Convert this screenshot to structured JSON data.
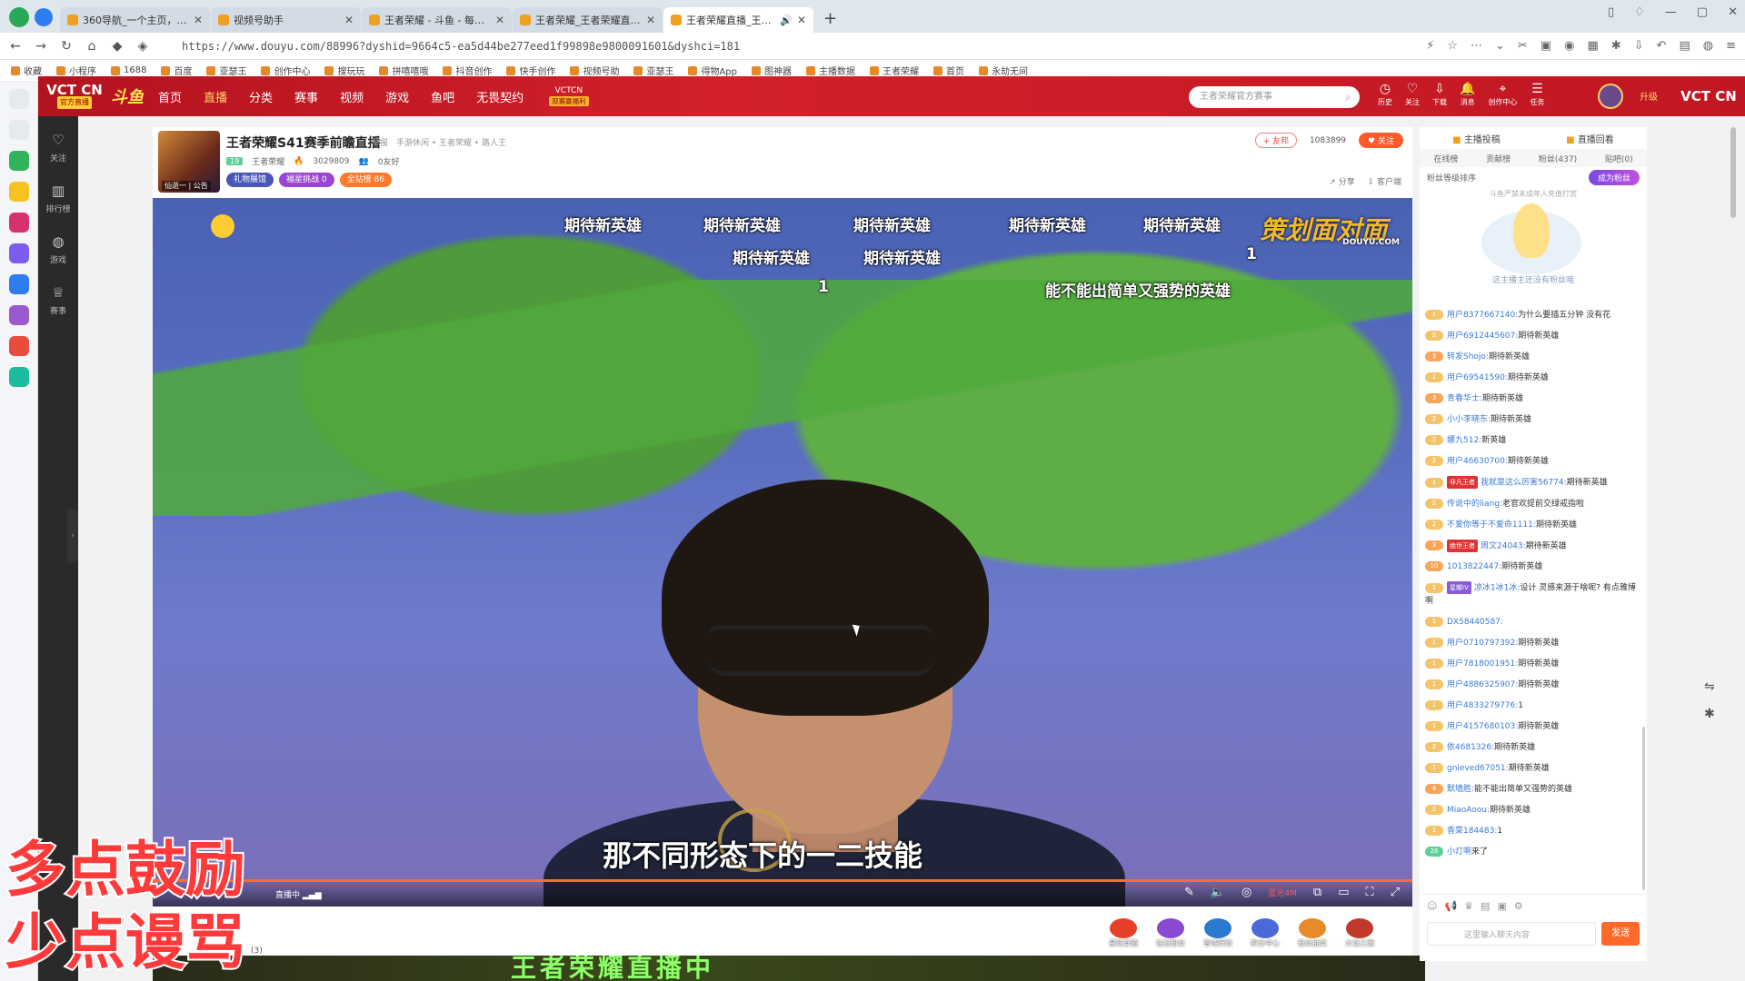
{
  "browser": {
    "tabs": [
      {
        "title": "360导航_一个主页，整个世界"
      },
      {
        "title": "视频号助手"
      },
      {
        "title": "王者荣耀 - 斗鱼 - 每个人的直"
      },
      {
        "title": "王者荣耀_王者荣耀直播_王者"
      },
      {
        "title": "王者荣耀直播_王者荣耀直"
      }
    ],
    "new_tab": "+",
    "url": "https://www.douyu.com/88996?dyshid=9664c5-ea5d44be277eed1f99898e9800091601&dyshci=181",
    "bookmarks": [
      "收藏",
      "小程序",
      "1688",
      "百度",
      "亚瑟王",
      "创作中心",
      "搜玩玩",
      "拼嘻嘻哦",
      "抖音创作",
      "快手创作",
      "视频号助",
      "亚瑟王",
      "得物App",
      "图神器",
      "主播数据",
      "王者荣耀",
      "首页",
      "永劫无间"
    ]
  },
  "site": {
    "vct_badge": "VCT CN",
    "vct_badge_sub": "官方直播",
    "logo": "斗鱼",
    "nav": [
      "首页",
      "直播",
      "分类",
      "赛事",
      "视频",
      "游戏",
      "鱼吧",
      "无畏契约"
    ],
    "nav_current": "直播",
    "vctcn_tag": "VCTCN",
    "vctcn_sub": "观赛赢福利",
    "search_placeholder": "王者荣耀官方赛事",
    "header_icons": [
      "历史",
      "关注",
      "下载",
      "消息",
      "创作中心",
      "任务"
    ],
    "upgrade": "升级"
  },
  "rail": [
    "关注",
    "排行榜",
    "游戏",
    "赛事"
  ],
  "room": {
    "avatar_tag": "仙逝一 | 公告",
    "title": "王者荣耀S41赛季前瞻直播",
    "report": "举报",
    "categories": "手游休闲 • 王者荣耀 • 路人王",
    "level": "19",
    "anchor": "王者荣耀",
    "heat": "3029809",
    "fans": "0友好",
    "badges": [
      "礼物展馆",
      "福星挑战 0",
      "全站榜 86"
    ],
    "share_btn": "+ 友邦",
    "count": "1083899",
    "follow_btn": "关注",
    "sub_actions": [
      "分享",
      "客户端"
    ]
  },
  "video": {
    "danmaku": [
      "期待新英雄",
      "期待新英雄",
      "期待新英雄",
      "期待新英雄",
      "期待新英雄",
      "期待新英雄",
      "期待新英雄",
      "1",
      "1",
      "能不能出简单又强势的英雄"
    ],
    "watermark": "策划面对面",
    "watermark_sub": "DOUYU.COM",
    "subtitle": "那不同形态下的一二技能",
    "live_label": "直播中",
    "quality": "蓝光4M",
    "progress_fraction": 1.0
  },
  "gifts": [
    "星际穿越",
    "钻石粉丝",
    "雪域历险",
    "积分中心",
    "粉丝抽奖",
    "大话三国"
  ],
  "gift_bottom": "(3)",
  "bottom_banner": "王者荣耀直播中",
  "overlay": [
    "多点鼓励",
    "少点谩骂"
  ],
  "chat": {
    "header": [
      "主播投稿",
      "直播回看"
    ],
    "tabs": [
      "在线榜",
      "贡献榜",
      "粉丝(437)",
      "贴吧(0)"
    ],
    "fan_rank_label": "粉丝等级排序",
    "fan_btn": "成为粉丝",
    "fan_note": "斗鱼严禁未成年人充值打赏",
    "fan_hint": "这主播主还没有粉丝哦",
    "messages": [
      {
        "lv": "1",
        "name": "用户8377667140:",
        "text": "为什么要插五分钟 没有花"
      },
      {
        "lv": "2",
        "name": "用户6912445607:",
        "text": "期待新英雄"
      },
      {
        "lv": "3",
        "name": "转发Shojo:",
        "text": "期待新英雄"
      },
      {
        "lv": "1",
        "name": "用户69541590:",
        "text": "期待新英雄"
      },
      {
        "lv": "3",
        "name": "青春华士:",
        "text": "期待新英雄"
      },
      {
        "lv": "2",
        "name": "小小李晓东:",
        "text": "期待新英雄"
      },
      {
        "lv": "2",
        "name": "娜九512:",
        "text": "新英雄"
      },
      {
        "lv": "2",
        "name": "用户46630700:",
        "text": "期待新英雄"
      },
      {
        "lv": "1",
        "badge": "非凡王者",
        "name": "我就是这么厉害56774:",
        "text": "期待新英雄"
      },
      {
        "lv": "2",
        "name": "传说中的liang:",
        "text": "老官欢提前交绿戒指啦"
      },
      {
        "lv": "2",
        "name": "不爱你等于不爱命1111:",
        "text": "期待新英雄"
      },
      {
        "lv": "3",
        "badge": "绝世王者",
        "name": "周文24043:",
        "text": "期待新英雄"
      },
      {
        "lv": "10",
        "name": "1013822447:",
        "text": "期待新英雄"
      },
      {
        "lv": "1",
        "badge": "星耀IV",
        "name": "凉冰1冰1冰:",
        "text": "设计 灵感来源于啥呢? 有点雅博啊"
      },
      {
        "lv": "1",
        "name": "DX58440587:",
        "text": ""
      },
      {
        "lv": "1",
        "name": "用户0710797392:",
        "text": "期待新英雄"
      },
      {
        "lv": "1",
        "name": "用户7818001951:",
        "text": "期待新英雄"
      },
      {
        "lv": "1",
        "name": "用户4886325907:",
        "text": "期待新英雄"
      },
      {
        "lv": "1",
        "name": "用户4833279776:",
        "text": "1"
      },
      {
        "lv": "1",
        "name": "用户4157680103:",
        "text": "期待新英雄"
      },
      {
        "lv": "2",
        "name": "依4681326:",
        "text": "期待新英雄"
      },
      {
        "lv": "1",
        "name": "gnieved67051:",
        "text": "期待新英雄"
      },
      {
        "lv": "4",
        "name": "默墙胜:",
        "text": "能不能出简单又强势的英雄"
      },
      {
        "lv": "2",
        "name": "MiaoAoou:",
        "text": "期待新英雄"
      },
      {
        "lv": "1",
        "name": "香菜184483:",
        "text": "1"
      },
      {
        "lv": "26",
        "name": "小灯啊",
        "text": "来了"
      }
    ],
    "input_placeholder": "这里输入聊天内容",
    "send": "发送"
  }
}
